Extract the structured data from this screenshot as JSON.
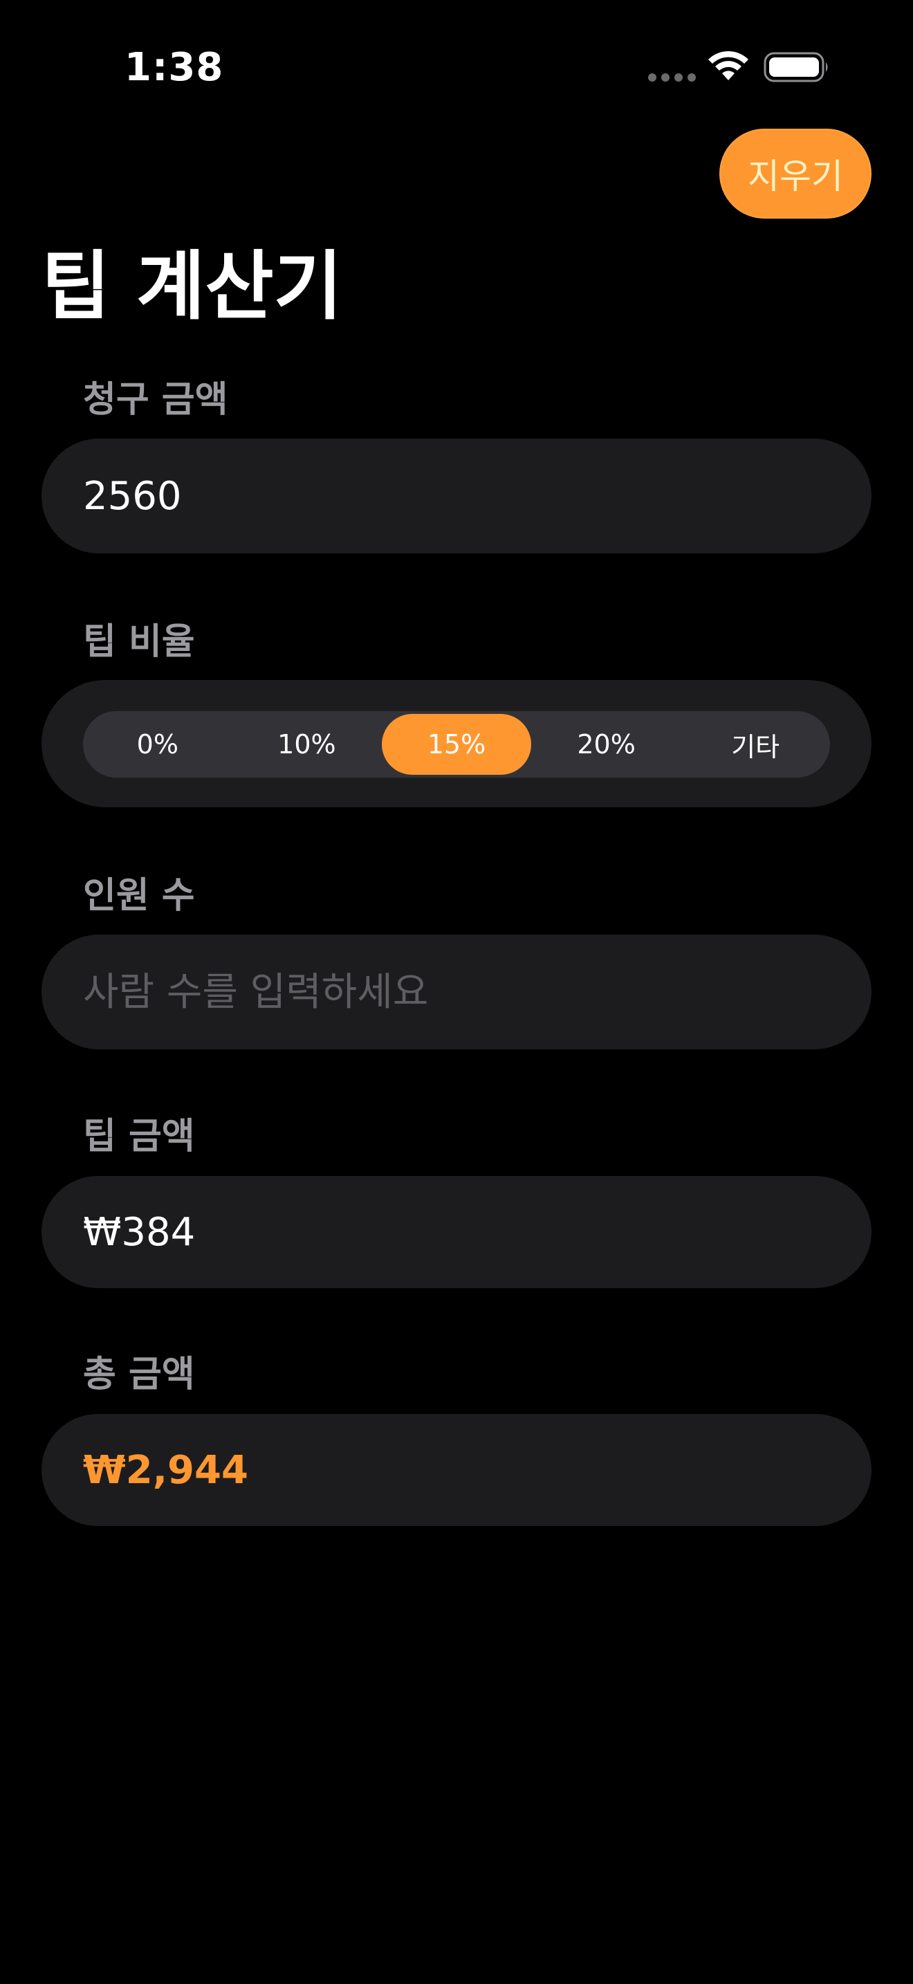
{
  "status_bar": {
    "time": "1:38"
  },
  "header": {
    "clear_label": "지우기",
    "title": "팁 계산기"
  },
  "bill": {
    "label": "청구 금액",
    "value": "2560"
  },
  "tip_rate": {
    "label": "팁 비율",
    "options": [
      "0%",
      "10%",
      "15%",
      "20%",
      "기타"
    ],
    "selected": "15%"
  },
  "people": {
    "label": "인원 수",
    "value": "",
    "placeholder": "사람 수를 입력하세요"
  },
  "tip_amount": {
    "label": "팁 금액",
    "value": "₩384"
  },
  "total": {
    "label": "총 금액",
    "value": "₩2,944"
  },
  "colors": {
    "accent": "#ff9730",
    "background": "#000000",
    "field_background": "#1c1c1e",
    "label": "#9a9a9f"
  }
}
